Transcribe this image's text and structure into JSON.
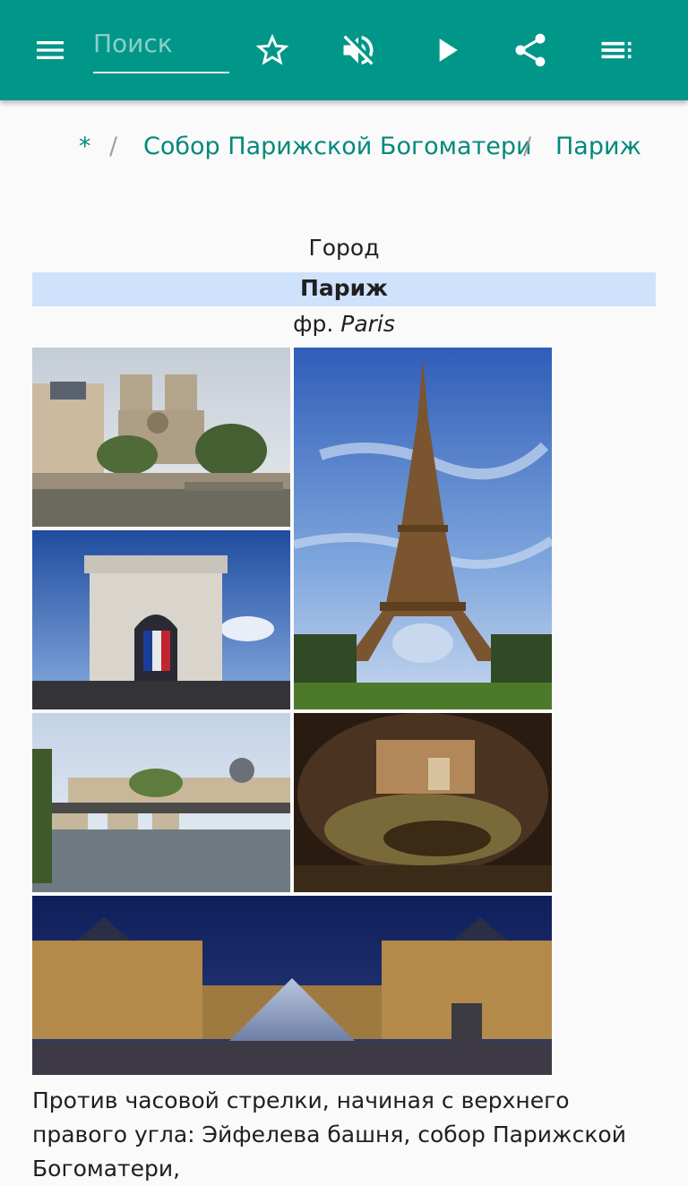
{
  "toolbar": {
    "search_placeholder": "Поиск",
    "icons": [
      "menu-icon",
      "star-outline-icon",
      "volume-off-icon",
      "play-icon",
      "share-icon",
      "playlist-icon"
    ],
    "color": "#009688"
  },
  "breadcrumb": {
    "items": [
      "*",
      "Собор Парижской Богоматери",
      "Париж"
    ],
    "separator": "/",
    "link_color": "#00897b"
  },
  "infobox": {
    "type": "Город",
    "title": "Париж",
    "native_prefix": "фр.",
    "native_name": "Paris",
    "title_bg": "#cfe2fc"
  },
  "collage": {
    "images": [
      "notre-dame",
      "eiffel-tower",
      "arc-de-triomphe",
      "pont-des-arts",
      "catacombs",
      "louvre"
    ]
  },
  "caption": {
    "text": "Против часовой стрелки, начиная с верхнего правого угла: Эйфелева башня, собор Парижской Богоматери,"
  }
}
